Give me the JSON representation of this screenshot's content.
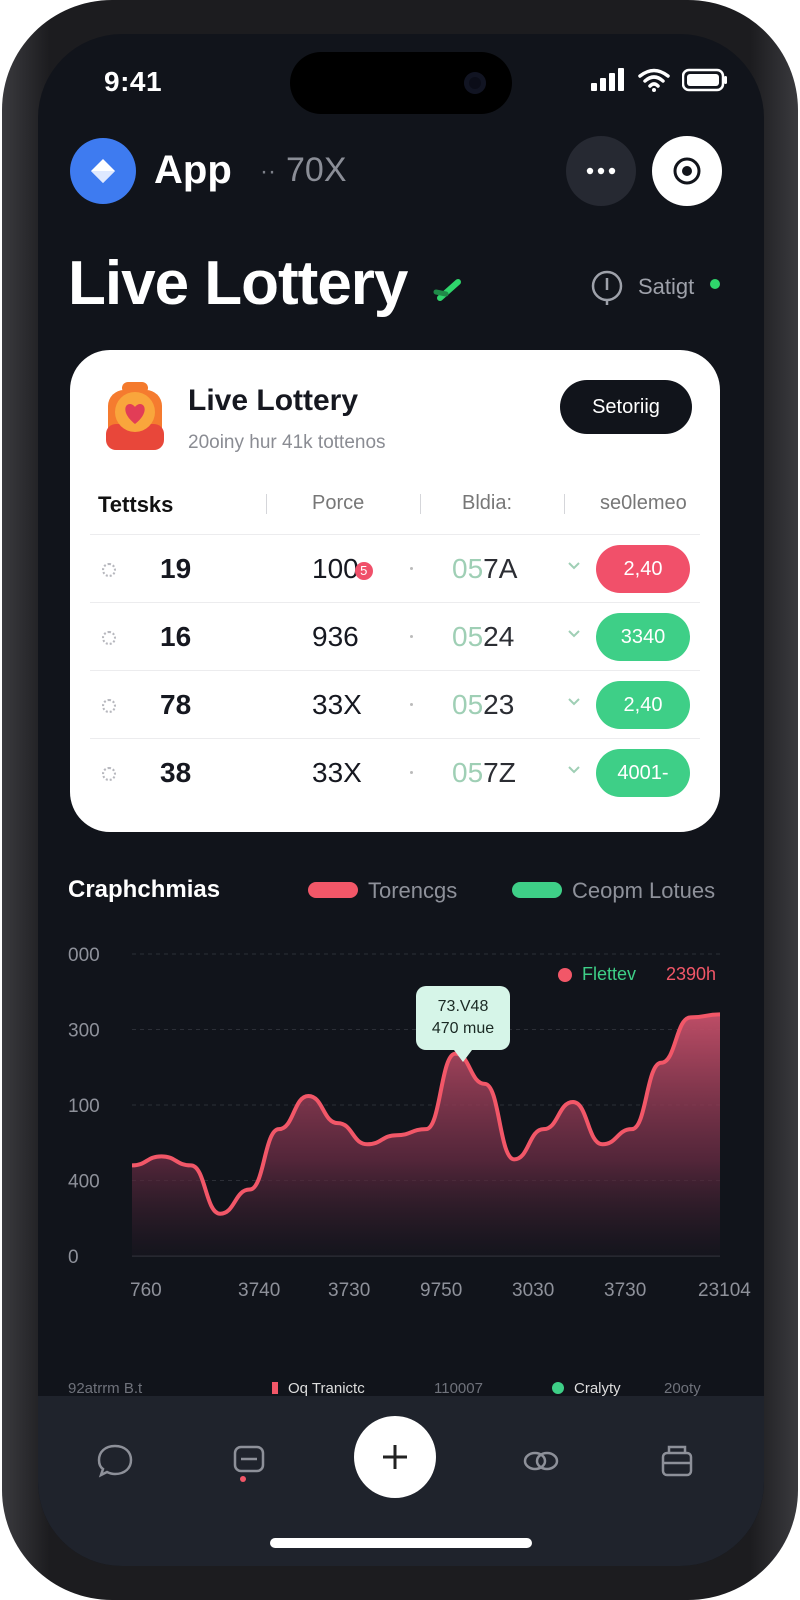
{
  "status_bar": {
    "time": "9:41"
  },
  "header": {
    "app_name": "App",
    "separator": "··",
    "count": "70X"
  },
  "page": {
    "title": "Live Lottery",
    "settings_label": "Satigt"
  },
  "card": {
    "title": "Live Lottery",
    "subtitle": "20oiny hur 41k tottenos",
    "button_label": "Setoriig",
    "columns": [
      "Tettsks",
      "Porce",
      "Bldia:",
      "se0lemeo"
    ],
    "rows": [
      {
        "ticket": "19",
        "price": "100",
        "price_badge": "5",
        "bid_faint": "05",
        "bid_strong": "7A",
        "volume": "2,40",
        "volume_color": "#f1506a"
      },
      {
        "ticket": "16",
        "price": "936",
        "price_badge": "",
        "bid_faint": "05",
        "bid_strong": "24",
        "volume": "3340",
        "volume_color": "#3ecf87"
      },
      {
        "ticket": "78",
        "price": "33X",
        "price_badge": "",
        "bid_faint": "05",
        "bid_strong": "23",
        "volume": "2,40",
        "volume_color": "#3ecf87"
      },
      {
        "ticket": "38",
        "price": "33X",
        "price_badge": "",
        "bid_faint": "05",
        "bid_strong": "7Z",
        "volume": "4001-",
        "volume_color": "#3ecf87"
      }
    ]
  },
  "chart_section": {
    "title": "Craphchmias",
    "legend": [
      {
        "label": "Torencgs",
        "color": "#f25768"
      },
      {
        "label": "Ceopm Lotues",
        "color": "#3ecf87"
      }
    ],
    "filter_label": "Flettev",
    "filter_value": "2390h",
    "tooltip_line1": "73.V48",
    "tooltip_line2": "470 mue"
  },
  "chart_data": {
    "type": "area",
    "x": [
      "760",
      "3740",
      "3730",
      "9750",
      "3030",
      "3730",
      "23104"
    ],
    "y_ticks": [
      "000",
      "300",
      "100",
      "400",
      "0"
    ],
    "series": [
      {
        "name": "Torencgs",
        "color": "#f25768",
        "values": [
          150,
          165,
          150,
          70,
          110,
          210,
          265,
          220,
          185,
          200,
          210,
          335,
          285,
          160,
          210,
          255,
          185,
          210,
          320,
          395,
          400
        ]
      }
    ],
    "ylim": [
      0,
      500
    ],
    "grid": true
  },
  "summary": {
    "left": "92atrrm B.t",
    "mid_label": "Oq Tranictc",
    "mid_value": "110007",
    "right_label": "Cralyty",
    "right_value": "20oty"
  },
  "icons": {
    "app_logo": "diamond-icon",
    "more": "ellipsis-icon",
    "target": "target-icon",
    "nav": [
      "chat-icon",
      "tickets-icon",
      "add-icon",
      "link-icon",
      "wallet-icon"
    ]
  },
  "colors": {
    "background": "#11141b",
    "accent_red": "#f25768",
    "accent_green": "#3ecf87",
    "brand_blue": "#3e7bf0"
  }
}
